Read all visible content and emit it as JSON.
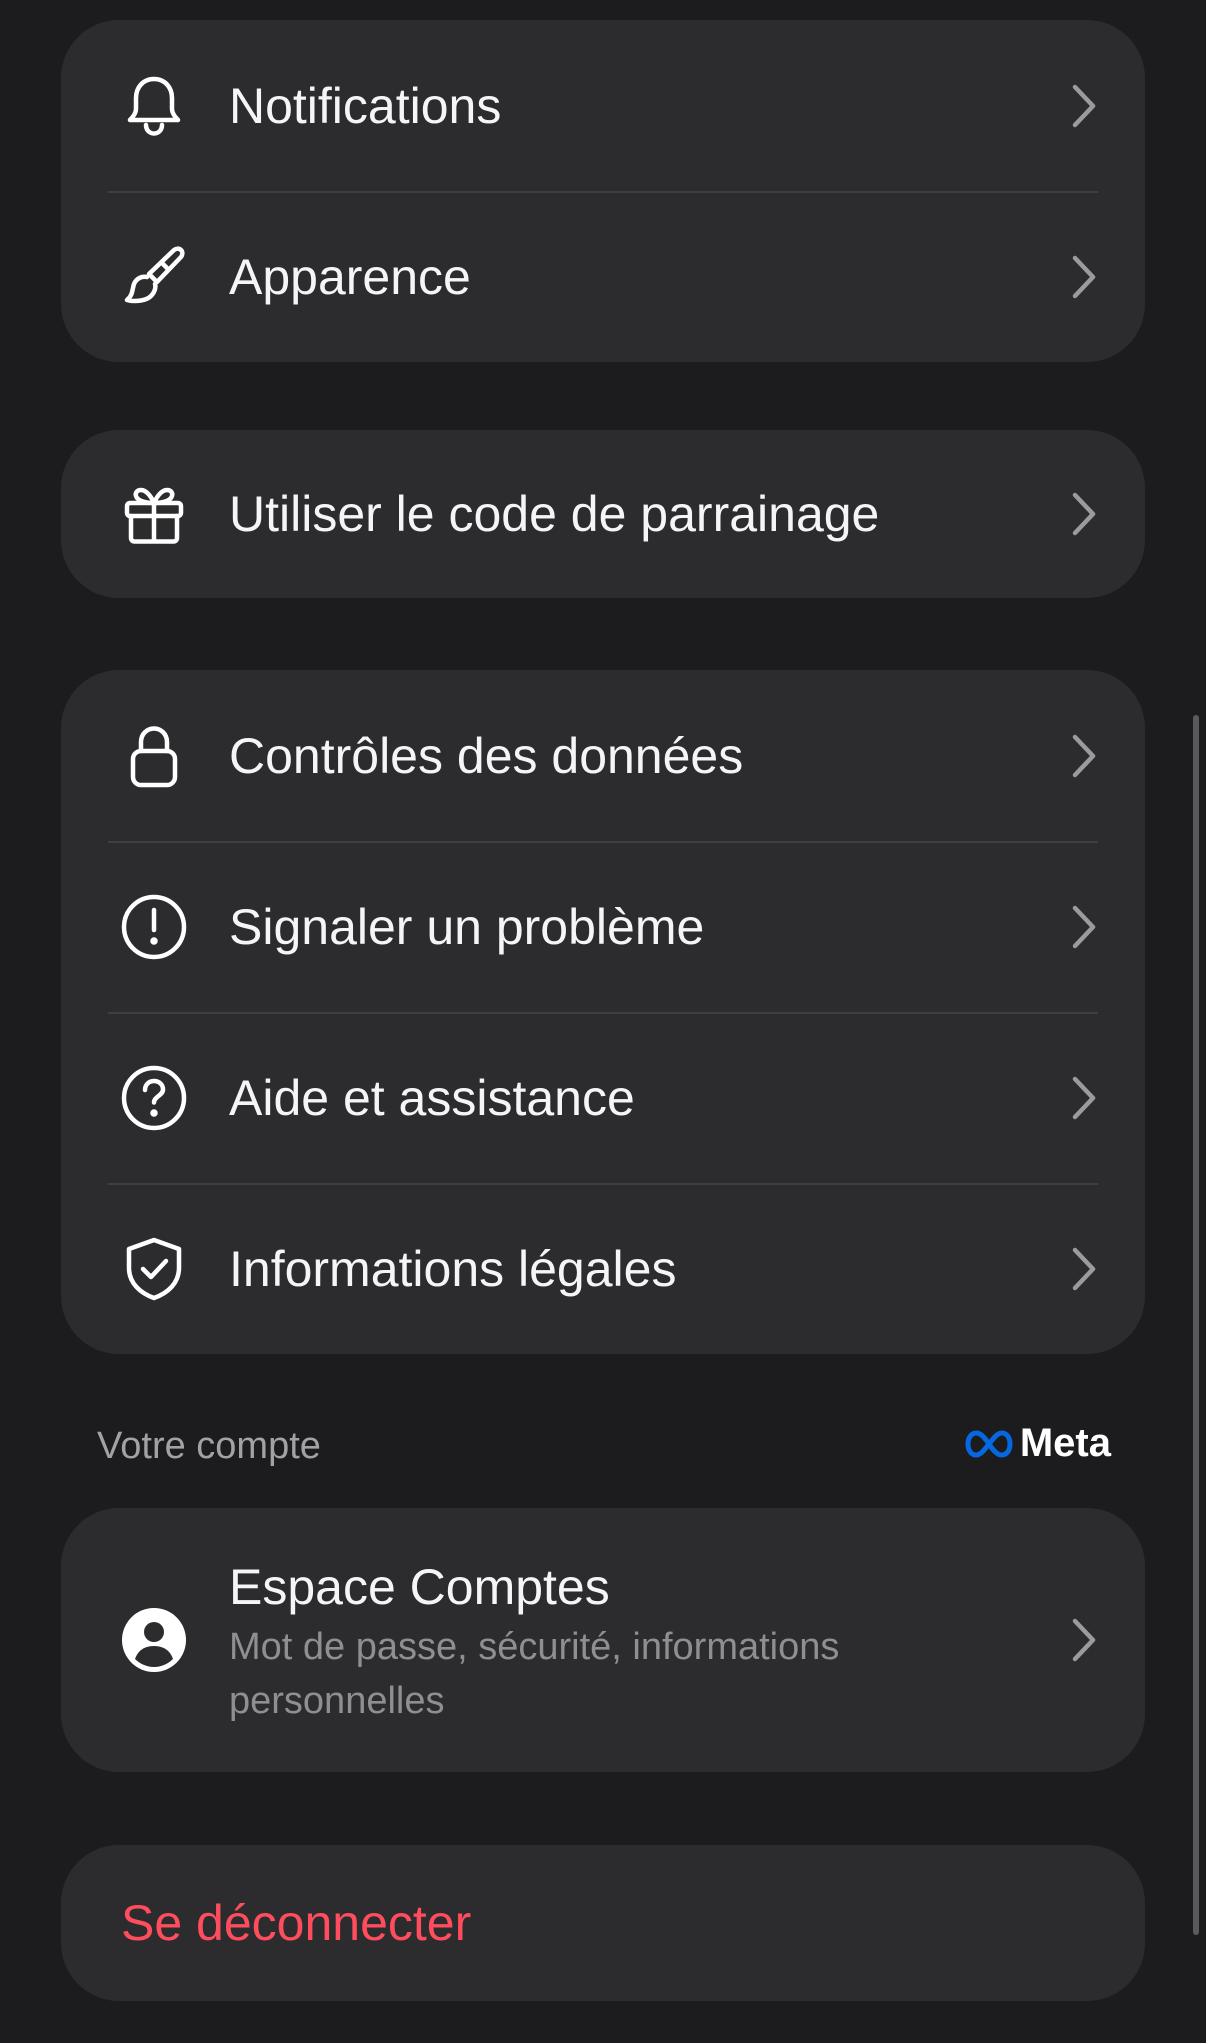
{
  "group1": {
    "items": [
      {
        "label": "Notifications",
        "icon": "bell-icon"
      },
      {
        "label": "Apparence",
        "icon": "paintbrush-icon"
      }
    ]
  },
  "group2": {
    "items": [
      {
        "label": "Utiliser le code de parrainage",
        "icon": "gift-icon"
      }
    ]
  },
  "group3": {
    "items": [
      {
        "label": "Contrôles des données",
        "icon": "lock-icon"
      },
      {
        "label": "Signaler un problème",
        "icon": "exclamation-circle-icon"
      },
      {
        "label": "Aide et assistance",
        "icon": "question-circle-icon"
      },
      {
        "label": "Informations légales",
        "icon": "shield-check-icon"
      }
    ]
  },
  "account_section": {
    "label": "Votre compte",
    "brand": "Meta",
    "brand_color": "#0668E1",
    "item": {
      "title": "Espace Comptes",
      "subtitle": "Mot de passe, sécurité, informations personnelles",
      "icon": "person-circle-icon"
    }
  },
  "logout": {
    "label": "Se déconnecter",
    "color": "#ff4d5e"
  },
  "chevron_icon": "chevron-right-icon"
}
